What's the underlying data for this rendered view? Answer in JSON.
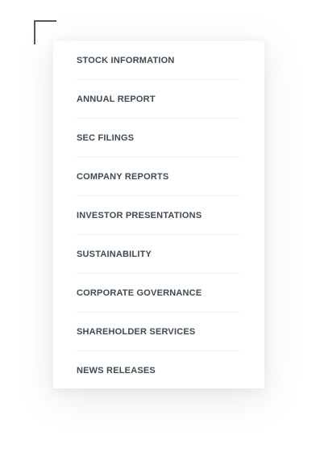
{
  "menu": {
    "items": [
      {
        "label": "STOCK INFORMATION"
      },
      {
        "label": "ANNUAL REPORT"
      },
      {
        "label": "SEC FILINGS"
      },
      {
        "label": "COMPANY REPORTS"
      },
      {
        "label": "INVESTOR PRESENTATIONS"
      },
      {
        "label": "SUSTAINABILITY"
      },
      {
        "label": "CORPORATE GOVERNANCE"
      },
      {
        "label": "SHAREHOLDER SERVICES"
      },
      {
        "label": "NEWS RELEASES"
      }
    ]
  },
  "colors": {
    "text": "#3f4a55",
    "divider": "#eef0f2",
    "bracket": "#555a60",
    "background": "#ffffff"
  }
}
